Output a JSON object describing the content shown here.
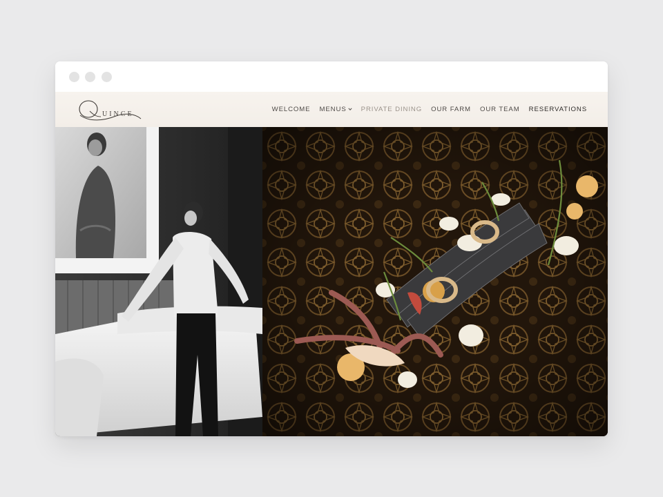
{
  "browser": {
    "window_controls": [
      "close-dot",
      "minimize-dot",
      "maximize-dot"
    ]
  },
  "site": {
    "logo_text": "UINCE",
    "logo_initial": "Q",
    "nav": [
      {
        "label": "WELCOME",
        "style": "normal"
      },
      {
        "label": "MENUS",
        "style": "normal",
        "has_dropdown": true
      },
      {
        "label": "PRIVATE DINING",
        "style": "muted"
      },
      {
        "label": "OUR FARM",
        "style": "normal"
      },
      {
        "label": "OUR TEAM",
        "style": "normal"
      },
      {
        "label": "RESERVATIONS",
        "style": "strong"
      }
    ]
  },
  "icons": {
    "menus_dropdown": "chevron-down-icon"
  },
  "colors": {
    "page_background": "#eaeaeb",
    "header_background": "#f5f1ec",
    "nav_text": "#4e4a47",
    "nav_muted": "#9a928a",
    "nav_strong": "#2e2b29"
  }
}
